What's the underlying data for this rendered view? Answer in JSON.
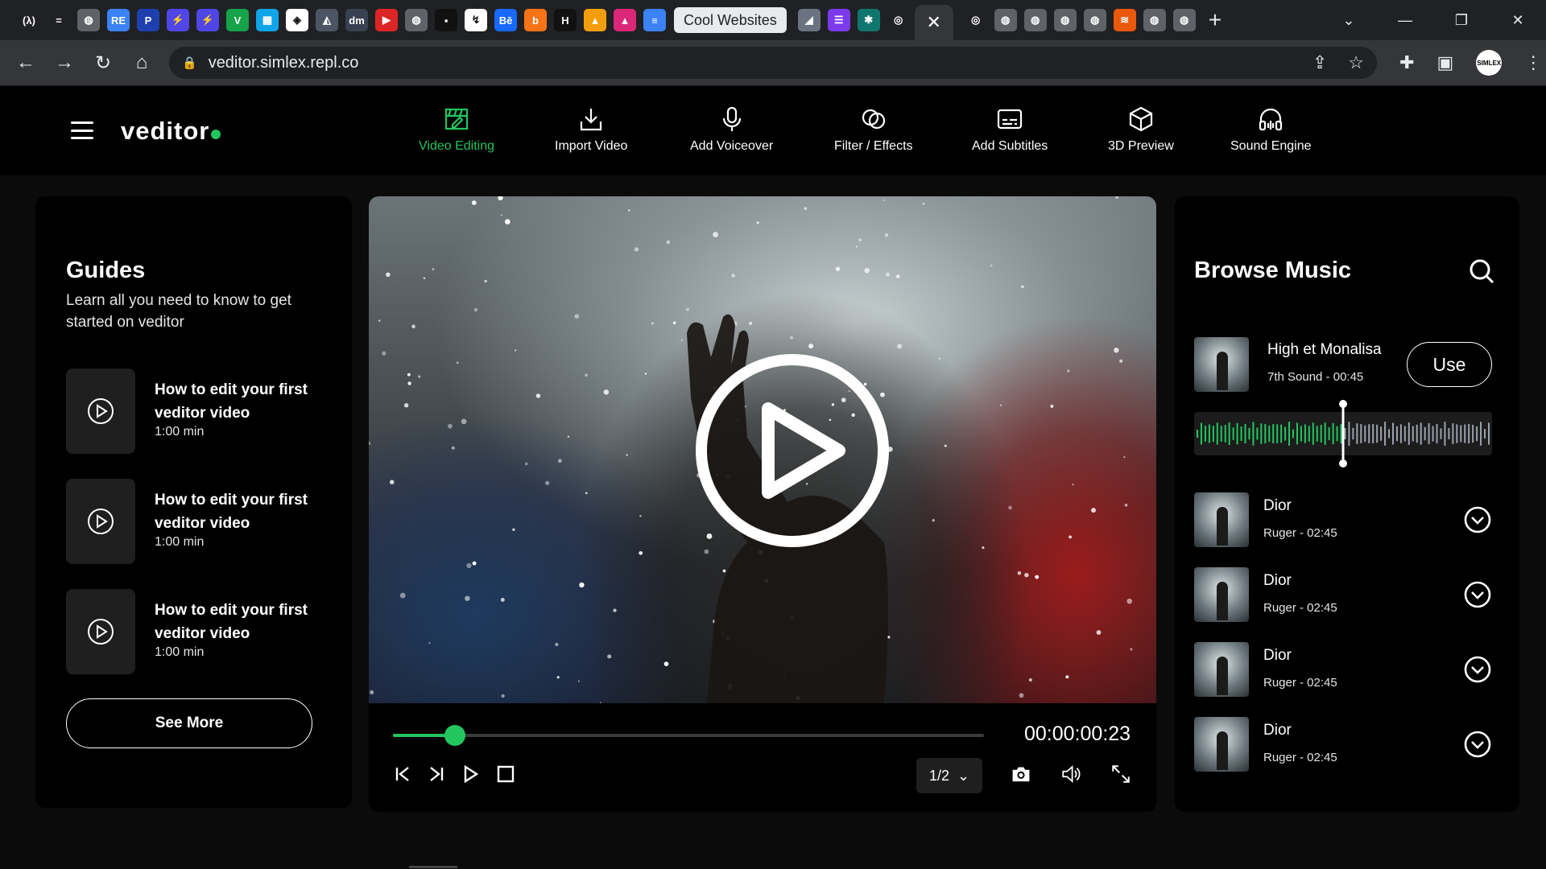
{
  "browser": {
    "tab_label": "Cool Websites",
    "active_tab_close": "✕",
    "new_tab": "+",
    "url": "veditor.simlex.repl.co",
    "avatar_text": "SIMLEX",
    "favicons": [
      {
        "glyph": "(λ)",
        "color": "#202124"
      },
      {
        "glyph": "=",
        "color": "#202124"
      },
      {
        "glyph": "◍",
        "color": "#5f6368"
      },
      {
        "glyph": "RE",
        "color": "#3b82f6"
      },
      {
        "glyph": "P",
        "color": "#1e40af"
      },
      {
        "glyph": "⚡",
        "color": "#4f46e5"
      },
      {
        "glyph": "⚡",
        "color": "#4f46e5"
      },
      {
        "glyph": "V",
        "color": "#16a34a"
      },
      {
        "glyph": "▦",
        "color": "#0ea5e9"
      },
      {
        "glyph": "◈",
        "color": "#ffffff"
      },
      {
        "glyph": "◭",
        "color": "#4b5563"
      },
      {
        "glyph": "dm",
        "color": "#374151"
      },
      {
        "glyph": "▶",
        "color": "#dc2626"
      },
      {
        "glyph": "◍",
        "color": "#5f6368"
      },
      {
        "glyph": "▪",
        "color": "#111111"
      },
      {
        "glyph": "↯",
        "color": "#ffffff"
      },
      {
        "glyph": "Bē",
        "color": "#1769ff"
      },
      {
        "glyph": "b",
        "color": "#f97316"
      },
      {
        "glyph": "H",
        "color": "#111111"
      },
      {
        "glyph": "▲",
        "color": "#f59e0b"
      },
      {
        "glyph": "▲",
        "color": "#db2777"
      },
      {
        "glyph": "≡",
        "color": "#3b82f6"
      }
    ],
    "after_tab_favicons": [
      {
        "glyph": "◢",
        "color": "#6b7280"
      },
      {
        "glyph": "☰",
        "color": "#7c3aed"
      },
      {
        "glyph": "✱",
        "color": "#0f766e"
      },
      {
        "glyph": "◎",
        "color": "#202124"
      }
    ],
    "right_favicons": [
      {
        "glyph": "◎",
        "color": "#202124"
      },
      {
        "glyph": "◍",
        "color": "#5f6368"
      },
      {
        "glyph": "◍",
        "color": "#5f6368"
      },
      {
        "glyph": "◍",
        "color": "#5f6368"
      },
      {
        "glyph": "◍",
        "color": "#5f6368"
      },
      {
        "glyph": "≋",
        "color": "#ea580c"
      },
      {
        "glyph": "◍",
        "color": "#5f6368"
      },
      {
        "glyph": "◍",
        "color": "#5f6368"
      }
    ]
  },
  "app": {
    "logo": "veditor",
    "accent_color": "#22c55e",
    "nav": [
      {
        "label": "Video Editing",
        "icon": "clapper-edit-icon",
        "active": true
      },
      {
        "label": "Import Video",
        "icon": "import-icon",
        "active": false
      },
      {
        "label": "Add Voiceover",
        "icon": "microphone-icon",
        "active": false
      },
      {
        "label": "Filter / Effects",
        "icon": "filter-icon",
        "active": false
      },
      {
        "label": "Add Subtitles",
        "icon": "subtitles-icon",
        "active": false
      },
      {
        "label": "3D Preview",
        "icon": "cube-icon",
        "active": false
      },
      {
        "label": "Sound Engine",
        "icon": "headphones-icon",
        "active": false
      }
    ]
  },
  "guides": {
    "title": "Guides",
    "subtitle": "Learn all you need to know to get started on veditor",
    "items": [
      {
        "title": "How to edit your first veditor video",
        "duration": "1:00 min"
      },
      {
        "title": "How to edit your first veditor video",
        "duration": "1:00 min"
      },
      {
        "title": "How to edit your first veditor video",
        "duration": "1:00 min"
      }
    ],
    "see_more": "See More"
  },
  "player": {
    "progress_fraction": 0.105,
    "timecode": "00:00:00:23",
    "page": "1/2"
  },
  "music": {
    "title": "Browse Music",
    "featured": {
      "name": "High et Monalisa",
      "meta": "7th Sound - 00:45",
      "use_label": "Use",
      "playhead_fraction": 0.5
    },
    "songs": [
      {
        "name": "Dior",
        "meta": "Ruger - 02:45"
      },
      {
        "name": "Dior",
        "meta": "Ruger - 02:45"
      },
      {
        "name": "Dior",
        "meta": "Ruger - 02:45"
      },
      {
        "name": "Dior",
        "meta": "Ruger - 02:45"
      }
    ]
  }
}
